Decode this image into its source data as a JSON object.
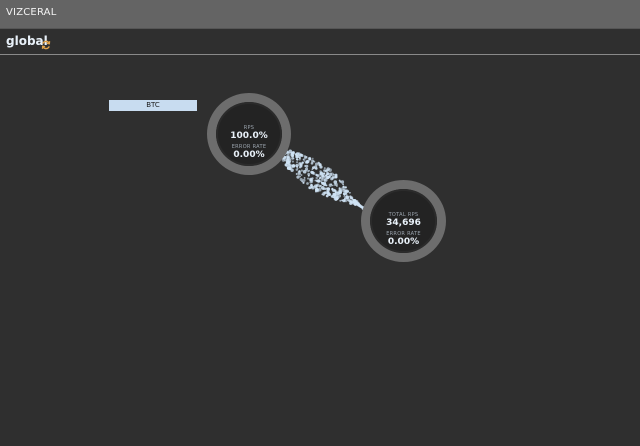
{
  "app": {
    "title": "VIZCERAL"
  },
  "header": {
    "breadcrumb": "global"
  },
  "graph": {
    "tag_label": "BTC",
    "nodes": {
      "btc": {
        "metric1_label": "RPS",
        "metric1_value": "100.0%",
        "metric2_label": "ERROR RATE",
        "metric2_value": "0.00%"
      },
      "internet": {
        "metric1_label": "TOTAL RPS",
        "metric1_value": "34,696",
        "metric2_label": "ERROR RATE",
        "metric2_value": "0.00%"
      }
    },
    "colors": {
      "particle": "#cfe3f5",
      "accent_refresh": "#e0a24a",
      "node_ring": "#6d6d6d"
    }
  }
}
